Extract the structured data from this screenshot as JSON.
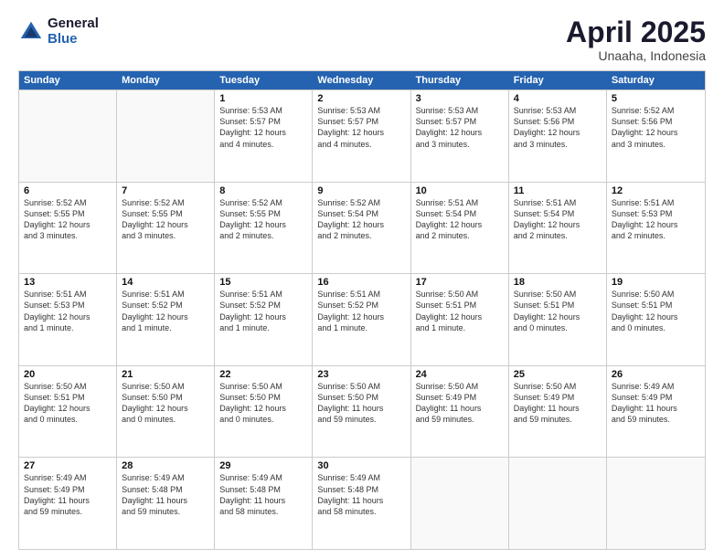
{
  "logo": {
    "general": "General",
    "blue": "Blue"
  },
  "title": "April 2025",
  "location": "Unaaha, Indonesia",
  "header_days": [
    "Sunday",
    "Monday",
    "Tuesday",
    "Wednesday",
    "Thursday",
    "Friday",
    "Saturday"
  ],
  "weeks": [
    [
      {
        "day": "",
        "info": ""
      },
      {
        "day": "",
        "info": ""
      },
      {
        "day": "1",
        "info": "Sunrise: 5:53 AM\nSunset: 5:57 PM\nDaylight: 12 hours\nand 4 minutes."
      },
      {
        "day": "2",
        "info": "Sunrise: 5:53 AM\nSunset: 5:57 PM\nDaylight: 12 hours\nand 4 minutes."
      },
      {
        "day": "3",
        "info": "Sunrise: 5:53 AM\nSunset: 5:57 PM\nDaylight: 12 hours\nand 3 minutes."
      },
      {
        "day": "4",
        "info": "Sunrise: 5:53 AM\nSunset: 5:56 PM\nDaylight: 12 hours\nand 3 minutes."
      },
      {
        "day": "5",
        "info": "Sunrise: 5:52 AM\nSunset: 5:56 PM\nDaylight: 12 hours\nand 3 minutes."
      }
    ],
    [
      {
        "day": "6",
        "info": "Sunrise: 5:52 AM\nSunset: 5:55 PM\nDaylight: 12 hours\nand 3 minutes."
      },
      {
        "day": "7",
        "info": "Sunrise: 5:52 AM\nSunset: 5:55 PM\nDaylight: 12 hours\nand 3 minutes."
      },
      {
        "day": "8",
        "info": "Sunrise: 5:52 AM\nSunset: 5:55 PM\nDaylight: 12 hours\nand 2 minutes."
      },
      {
        "day": "9",
        "info": "Sunrise: 5:52 AM\nSunset: 5:54 PM\nDaylight: 12 hours\nand 2 minutes."
      },
      {
        "day": "10",
        "info": "Sunrise: 5:51 AM\nSunset: 5:54 PM\nDaylight: 12 hours\nand 2 minutes."
      },
      {
        "day": "11",
        "info": "Sunrise: 5:51 AM\nSunset: 5:54 PM\nDaylight: 12 hours\nand 2 minutes."
      },
      {
        "day": "12",
        "info": "Sunrise: 5:51 AM\nSunset: 5:53 PM\nDaylight: 12 hours\nand 2 minutes."
      }
    ],
    [
      {
        "day": "13",
        "info": "Sunrise: 5:51 AM\nSunset: 5:53 PM\nDaylight: 12 hours\nand 1 minute."
      },
      {
        "day": "14",
        "info": "Sunrise: 5:51 AM\nSunset: 5:52 PM\nDaylight: 12 hours\nand 1 minute."
      },
      {
        "day": "15",
        "info": "Sunrise: 5:51 AM\nSunset: 5:52 PM\nDaylight: 12 hours\nand 1 minute."
      },
      {
        "day": "16",
        "info": "Sunrise: 5:51 AM\nSunset: 5:52 PM\nDaylight: 12 hours\nand 1 minute."
      },
      {
        "day": "17",
        "info": "Sunrise: 5:50 AM\nSunset: 5:51 PM\nDaylight: 12 hours\nand 1 minute."
      },
      {
        "day": "18",
        "info": "Sunrise: 5:50 AM\nSunset: 5:51 PM\nDaylight: 12 hours\nand 0 minutes."
      },
      {
        "day": "19",
        "info": "Sunrise: 5:50 AM\nSunset: 5:51 PM\nDaylight: 12 hours\nand 0 minutes."
      }
    ],
    [
      {
        "day": "20",
        "info": "Sunrise: 5:50 AM\nSunset: 5:51 PM\nDaylight: 12 hours\nand 0 minutes."
      },
      {
        "day": "21",
        "info": "Sunrise: 5:50 AM\nSunset: 5:50 PM\nDaylight: 12 hours\nand 0 minutes."
      },
      {
        "day": "22",
        "info": "Sunrise: 5:50 AM\nSunset: 5:50 PM\nDaylight: 12 hours\nand 0 minutes."
      },
      {
        "day": "23",
        "info": "Sunrise: 5:50 AM\nSunset: 5:50 PM\nDaylight: 11 hours\nand 59 minutes."
      },
      {
        "day": "24",
        "info": "Sunrise: 5:50 AM\nSunset: 5:49 PM\nDaylight: 11 hours\nand 59 minutes."
      },
      {
        "day": "25",
        "info": "Sunrise: 5:50 AM\nSunset: 5:49 PM\nDaylight: 11 hours\nand 59 minutes."
      },
      {
        "day": "26",
        "info": "Sunrise: 5:49 AM\nSunset: 5:49 PM\nDaylight: 11 hours\nand 59 minutes."
      }
    ],
    [
      {
        "day": "27",
        "info": "Sunrise: 5:49 AM\nSunset: 5:49 PM\nDaylight: 11 hours\nand 59 minutes."
      },
      {
        "day": "28",
        "info": "Sunrise: 5:49 AM\nSunset: 5:48 PM\nDaylight: 11 hours\nand 59 minutes."
      },
      {
        "day": "29",
        "info": "Sunrise: 5:49 AM\nSunset: 5:48 PM\nDaylight: 11 hours\nand 58 minutes."
      },
      {
        "day": "30",
        "info": "Sunrise: 5:49 AM\nSunset: 5:48 PM\nDaylight: 11 hours\nand 58 minutes."
      },
      {
        "day": "",
        "info": ""
      },
      {
        "day": "",
        "info": ""
      },
      {
        "day": "",
        "info": ""
      }
    ]
  ]
}
